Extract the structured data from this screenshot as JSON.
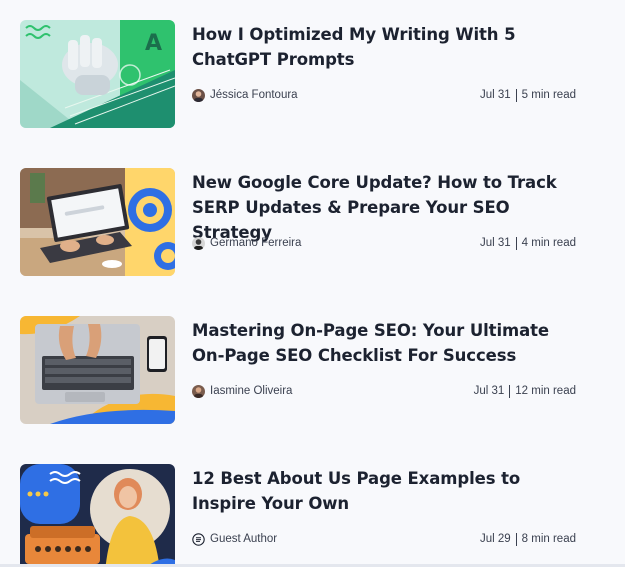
{
  "articles": [
    {
      "title": "How I Optimized My Writing With 5 ChatGPT Prompts",
      "author": "Jéssica Fontoura",
      "date": "Jul 31",
      "read_time": "5 min read",
      "thumbnail": "robot-hand-keyboard-illustration",
      "avatar": "photo-avatar"
    },
    {
      "title": "New Google Core Update? How to Track SERP Updates & Prepare Your SEO Strategy",
      "author": "Germano Ferreira",
      "date": "Jul 31",
      "read_time": "4 min read",
      "thumbnail": "laptop-google-gears-illustration",
      "avatar": "photo-avatar"
    },
    {
      "title": "Mastering On-Page SEO: Your Ultimate On-Page SEO Checklist For Success",
      "author": "Iasmine Oliveira",
      "date": "Jul 31",
      "read_time": "12 min read",
      "thumbnail": "hands-typing-laptop-illustration",
      "avatar": "photo-avatar"
    },
    {
      "title": "12 Best About Us Page Examples to Inspire Your Own",
      "author": "Guest Author",
      "date": "Jul 29",
      "read_time": "8 min read",
      "thumbnail": "woman-typewriter-illustration",
      "avatar": "document-icon"
    }
  ],
  "colors": {
    "background": "#f8f9fc",
    "title": "#1c2230",
    "meta": "#3b4150",
    "accent_blue": "#2f6fe4",
    "accent_yellow": "#f7c948",
    "accent_green": "#2fc26e"
  }
}
